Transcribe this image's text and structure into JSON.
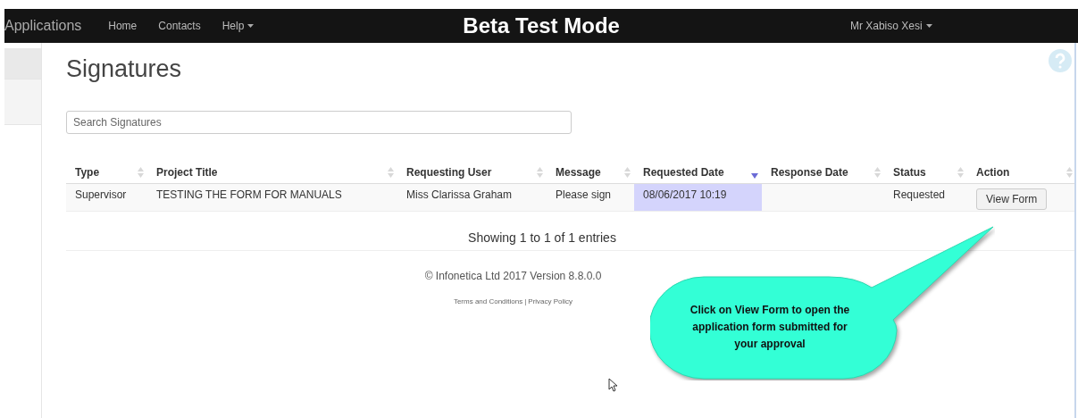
{
  "navbar": {
    "brand": "Applications",
    "links": [
      {
        "label": "Home",
        "dropdown": false
      },
      {
        "label": "Contacts",
        "dropdown": false
      },
      {
        "label": "Help",
        "dropdown": true
      }
    ],
    "banner": "Beta Test Mode",
    "user": {
      "label": "Mr Xabiso Xesi",
      "dropdown": true
    }
  },
  "page": {
    "title": "Signatures"
  },
  "search": {
    "placeholder": "Search Signatures"
  },
  "table": {
    "columns": [
      {
        "label": "Type",
        "sorted": false
      },
      {
        "label": "Project Title",
        "sorted": false
      },
      {
        "label": "Requesting User",
        "sorted": false
      },
      {
        "label": "Message",
        "sorted": false
      },
      {
        "label": "Requested Date",
        "sorted": true
      },
      {
        "label": "Response Date",
        "sorted": false
      },
      {
        "label": "Status",
        "sorted": false
      },
      {
        "label": "Action",
        "sorted": false
      }
    ],
    "rows": [
      {
        "cells": [
          "Supervisor",
          "TESTING THE FORM FOR MANUALS",
          "Miss Clarissa Graham",
          "Please sign",
          "08/06/2017 10:19",
          "",
          "Requested"
        ],
        "action": "View Form"
      }
    ],
    "info": "Showing 1 to 1 of 1 entries"
  },
  "footer": {
    "copyright": "© Infonetica Ltd 2017 Version 8.8.0.0",
    "links": [
      "Terms and Conditions",
      "Privacy Policy"
    ],
    "separator": "|"
  },
  "callout": {
    "text": "Click on View Form to open the application form submitted for your approval"
  }
}
